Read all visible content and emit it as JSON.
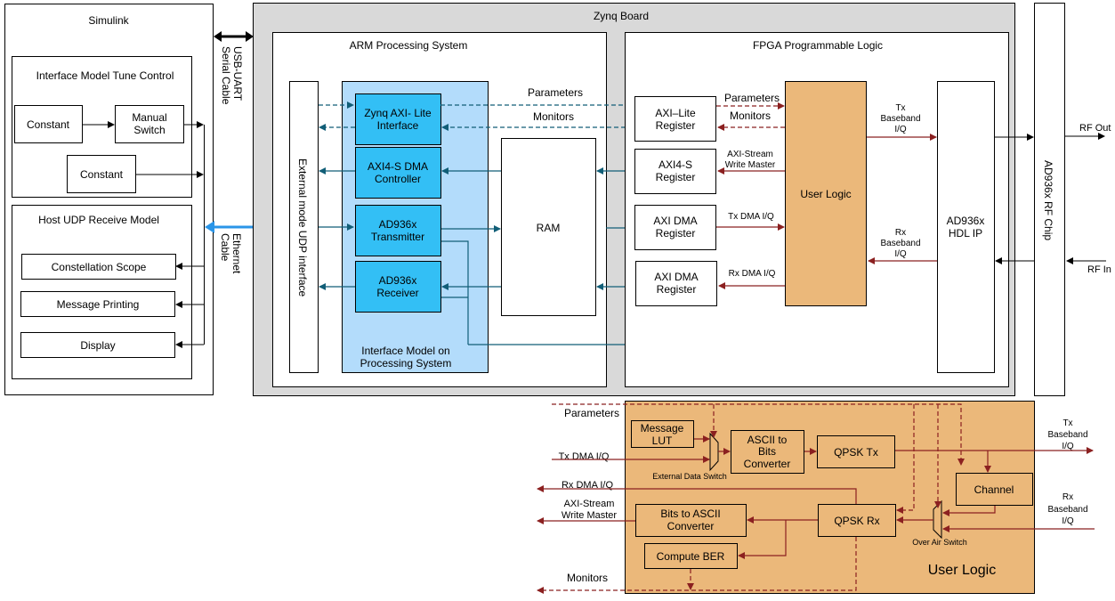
{
  "colors": {
    "teal_wire": "#115e77",
    "red_wire": "#8b2020",
    "ethernet": "#2a95e8",
    "board_bg": "#d9d9d9",
    "interface_model_bg": "#b3dcfb",
    "ps_block_bg": "#33bff5",
    "user_logic_bg": "#ebb87a"
  },
  "simulink": {
    "title": "Simulink",
    "tune_control": {
      "title": "Interface Model Tune Control",
      "constant1": "Constant",
      "manual_switch": [
        "Manual",
        "Switch"
      ],
      "constant2": "Constant"
    },
    "udp_receive": {
      "title": "Host UDP Receive Model",
      "constellation": "Constellation Scope",
      "message_printing": "Message Printing",
      "display": "Display"
    }
  },
  "cables": {
    "usb": [
      "USB-UART",
      "Serial Cable"
    ],
    "ethernet": [
      "Ethernet",
      "Cable"
    ]
  },
  "zynq": {
    "title": "Zynq Board",
    "arm": {
      "title": "ARM Processing System",
      "udp_interface": "External mode UDP interface",
      "interface_model": [
        "Interface Model on",
        "Processing System"
      ],
      "axi_lite": [
        "Zynq AXI- Lite",
        "Interface"
      ],
      "dma_ctrl": [
        "AXI4-S DMA",
        "Controller"
      ],
      "transmitter": [
        "AD936x",
        "Transmitter"
      ],
      "receiver": [
        "AD936x",
        "Receiver"
      ],
      "ram": "RAM",
      "parameters": "Parameters",
      "monitors": "Monitors"
    },
    "fpga": {
      "title": "FPGA Programmable Logic",
      "axi_lite_reg": [
        "AXI–Lite",
        "Register"
      ],
      "axi4s_reg": [
        "AXI4-S",
        "Register"
      ],
      "dma_reg_tx": [
        "AXI DMA",
        "Register"
      ],
      "dma_reg_rx": [
        "AXI DMA",
        "Register"
      ],
      "user_logic": "User Logic",
      "hdl_ip": [
        "AD936x",
        "HDL IP"
      ],
      "parameters": "Parameters",
      "monitors": "Monitors",
      "axi_stream": [
        "AXI-Stream",
        "Write Master"
      ],
      "tx_dma": "Tx DMA I/Q",
      "rx_dma": "Rx DMA I/Q",
      "tx_baseband": [
        "Tx",
        "Baseband",
        "I/Q"
      ],
      "rx_baseband": [
        "Rx",
        "Baseband",
        "I/Q"
      ]
    }
  },
  "rf_chip": {
    "title": "AD936x RF Chip",
    "rf_out": "RF Out",
    "rf_in": "RF In"
  },
  "user_logic_detail": {
    "title": "User Logic",
    "parameters": "Parameters",
    "tx_dma": "Tx DMA I/Q",
    "rx_dma": "Rx DMA I/Q",
    "axi_stream": [
      "AXI-Stream",
      "Write Master"
    ],
    "monitors": "Monitors",
    "message_lut": [
      "Message",
      "LUT"
    ],
    "ext_switch": "External Data Switch",
    "ascii_to_bits": [
      "ASCII to",
      "Bits",
      "Converter"
    ],
    "qpsk_tx": "QPSK Tx",
    "channel": "Channel",
    "qpsk_rx": "QPSK Rx",
    "over_air_switch": "Over Air Switch",
    "bits_to_ascii": [
      "Bits to ASCII",
      "Converter"
    ],
    "compute_ber": "Compute BER",
    "tx_baseband": [
      "Tx",
      "Baseband",
      "I/Q"
    ],
    "rx_baseband": [
      "Rx",
      "Baseband",
      "I/Q"
    ]
  }
}
